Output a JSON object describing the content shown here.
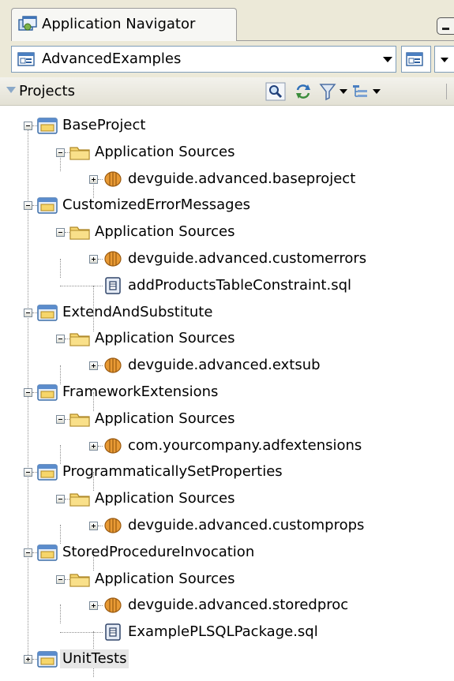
{
  "header": {
    "tab_title": "Application Navigator"
  },
  "app_selector": {
    "selected": "AdvancedExamples"
  },
  "projects_panel": {
    "label": "Projects"
  },
  "tree": [
    {
      "label": "BaseProject",
      "kind": "project",
      "expanded": true
    },
    {
      "label": "Application Sources",
      "kind": "folder",
      "expanded": true
    },
    {
      "label": "devguide.advanced.baseproject",
      "kind": "package",
      "expanded": false
    },
    {
      "label": "CustomizedErrorMessages",
      "kind": "project",
      "expanded": true
    },
    {
      "label": "Application Sources",
      "kind": "folder",
      "expanded": true
    },
    {
      "label": "devguide.advanced.customerrors",
      "kind": "package",
      "expanded": false
    },
    {
      "label": "addProductsTableConstraint.sql",
      "kind": "sql",
      "expanded": null
    },
    {
      "label": "ExtendAndSubstitute",
      "kind": "project",
      "expanded": true
    },
    {
      "label": "Application Sources",
      "kind": "folder",
      "expanded": true
    },
    {
      "label": "devguide.advanced.extsub",
      "kind": "package",
      "expanded": false
    },
    {
      "label": "FrameworkExtensions",
      "kind": "project",
      "expanded": true
    },
    {
      "label": "Application Sources",
      "kind": "folder",
      "expanded": true
    },
    {
      "label": "com.yourcompany.adfextensions",
      "kind": "package",
      "expanded": false
    },
    {
      "label": "ProgrammaticallySetProperties",
      "kind": "project",
      "expanded": true
    },
    {
      "label": "Application Sources",
      "kind": "folder",
      "expanded": true
    },
    {
      "label": "devguide.advanced.customprops",
      "kind": "package",
      "expanded": false
    },
    {
      "label": "StoredProcedureInvocation",
      "kind": "project",
      "expanded": true
    },
    {
      "label": "Application Sources",
      "kind": "folder",
      "expanded": true
    },
    {
      "label": "devguide.advanced.storedproc",
      "kind": "package",
      "expanded": false
    },
    {
      "label": "ExamplePLSQLPackage.sql",
      "kind": "sql",
      "expanded": null
    },
    {
      "label": "UnitTests",
      "kind": "project",
      "expanded": false,
      "selected": true
    }
  ],
  "icons": {
    "tab": "application-navigator-icon",
    "app_selector": "application-workspace-icon",
    "toolbar": [
      "search-icon",
      "refresh-icon",
      "filter-icon",
      "sort-options-icon"
    ],
    "project": "project-folder-icon",
    "folder": "folder-icon",
    "package": "package-icon",
    "sql": "sql-file-icon"
  },
  "colors": {
    "chrome": "#ece9d8",
    "selected_row": "#e6e6e6",
    "folder": "#f2d36a",
    "package": "#e0952c"
  }
}
